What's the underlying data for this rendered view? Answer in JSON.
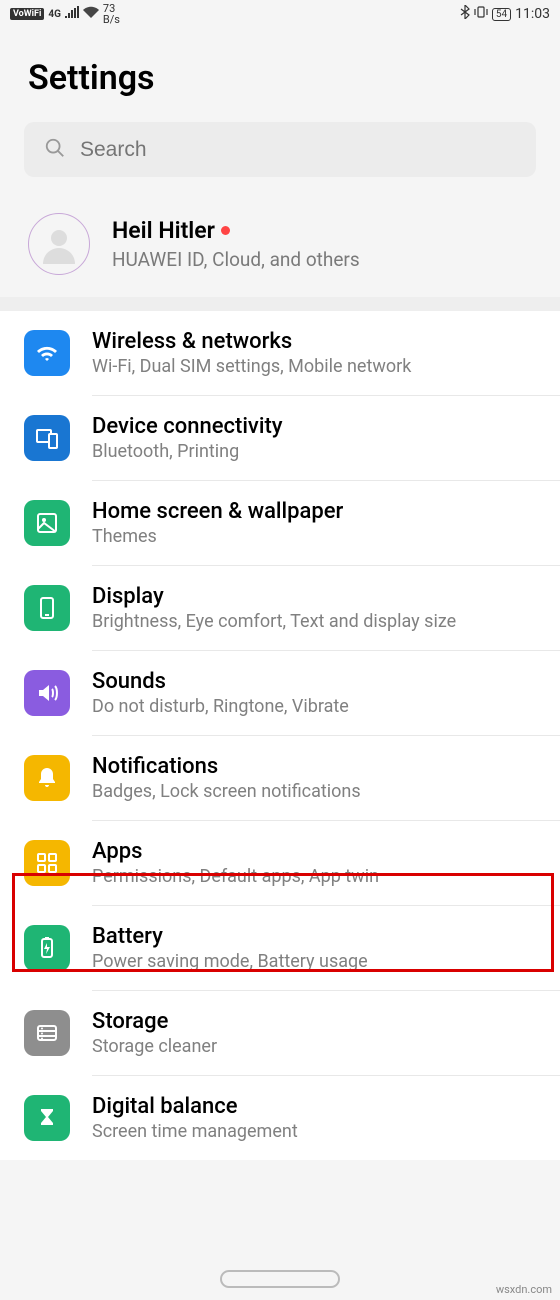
{
  "status": {
    "vowifi": "VoWiFi",
    "net_gen": "4G",
    "speed_val": "73",
    "speed_unit": "B/s",
    "battery": "54",
    "time": "11:03"
  },
  "header": {
    "title": "Settings"
  },
  "search": {
    "placeholder": "Search"
  },
  "account": {
    "name": "Heil Hitler",
    "subtitle": "HUAWEI ID, Cloud, and others"
  },
  "items": [
    {
      "icon": "wifi-icon",
      "color": "c-blue",
      "title": "Wireless & networks",
      "sub": "Wi-Fi, Dual SIM settings, Mobile network"
    },
    {
      "icon": "device-icon",
      "color": "c-blue2",
      "title": "Device connectivity",
      "sub": "Bluetooth, Printing"
    },
    {
      "icon": "wallpaper-icon",
      "color": "c-green",
      "title": "Home screen & wallpaper",
      "sub": "Themes"
    },
    {
      "icon": "display-icon",
      "color": "c-green2",
      "title": "Display",
      "sub": "Brightness, Eye comfort, Text and display size"
    },
    {
      "icon": "sound-icon",
      "color": "c-purple",
      "title": "Sounds",
      "sub": "Do not disturb, Ringtone, Vibrate"
    },
    {
      "icon": "notification-icon",
      "color": "c-yellow",
      "title": "Notifications",
      "sub": "Badges, Lock screen notifications"
    },
    {
      "icon": "apps-icon",
      "color": "c-yellow",
      "title": "Apps",
      "sub": "Permissions, Default apps, App twin"
    },
    {
      "icon": "battery-icon",
      "color": "c-teal",
      "title": "Battery",
      "sub": "Power saving mode, Battery usage"
    },
    {
      "icon": "storage-icon",
      "color": "c-grey",
      "title": "Storage",
      "sub": "Storage cleaner"
    },
    {
      "icon": "hourglass-icon",
      "color": "c-teal",
      "title": "Digital balance",
      "sub": "Screen time management"
    }
  ],
  "watermark": "wsxdn.com"
}
